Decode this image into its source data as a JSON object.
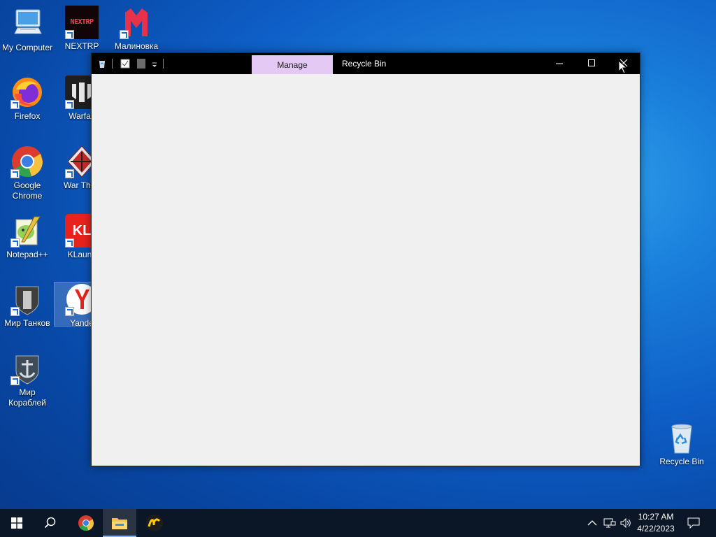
{
  "desktop": {
    "icons": [
      {
        "label": "My Computer"
      },
      {
        "label": "NEXTRP"
      },
      {
        "label": "Малиновка"
      },
      {
        "label": "Firefox"
      },
      {
        "label": "Warfac"
      },
      {
        "label": "Google Chrome"
      },
      {
        "label": "War Thun"
      },
      {
        "label": "Notepad++"
      },
      {
        "label": "KLaunc"
      },
      {
        "label": "Мир Танков"
      },
      {
        "label": "Yande"
      },
      {
        "label": "Мир Кораблей"
      },
      {
        "label": "Recycle Bin"
      }
    ],
    "nextrp_logo_text": "NEXTRP",
    "kl_logo_text": "KL"
  },
  "window": {
    "title": "Recycle Bin",
    "manage_tab": "Manage",
    "controls": [
      "minimize-icon",
      "maximize-icon",
      "close-icon"
    ]
  },
  "taskbar": {
    "time": "10:27 AM",
    "date": "4/22/2023",
    "items": [
      "start-icon",
      "search-icon",
      "chrome-icon",
      "file-explorer-icon",
      "yandex-music-icon"
    ],
    "tray": [
      "chevron-up-icon",
      "network-icon",
      "volume-icon",
      "notification-icon"
    ]
  },
  "colors": {
    "accent_manage": "#e3c9f4",
    "titlebar": "#000000",
    "taskbar": "#0b1626"
  }
}
